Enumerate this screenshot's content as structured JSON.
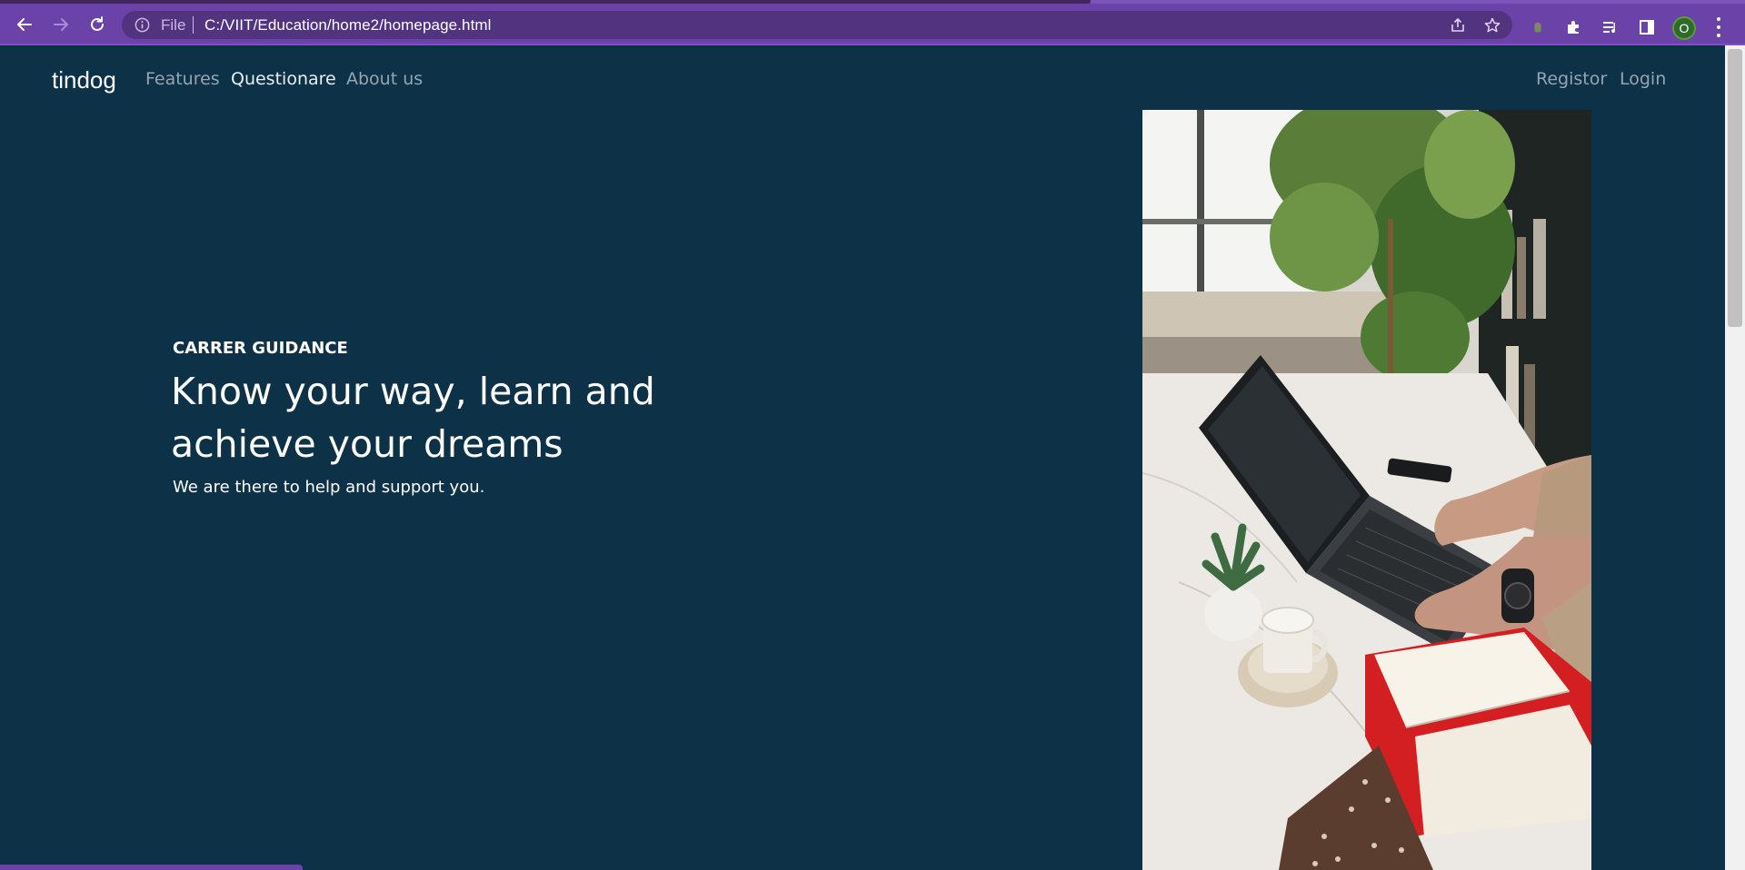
{
  "browser": {
    "omnibox": {
      "scheme_label": "File",
      "url": "C:/VIIT/Education/home2/homepage.html"
    },
    "profile_initial": "O",
    "icons": {
      "back": "back-arrow-icon",
      "forward": "forward-arrow-icon",
      "reload": "reload-icon",
      "info": "info-icon",
      "share": "share-icon",
      "bookmark": "star-icon",
      "extension1": "extension-icon",
      "extensions": "puzzle-icon",
      "media": "media-queue-icon",
      "side_panel": "side-panel-icon",
      "menu": "kebab-menu-icon"
    },
    "colors": {
      "frame": "#6a42a8",
      "omnibox": "#52337f"
    }
  },
  "navbar": {
    "brand": "tindog",
    "links": [
      "Features",
      "Questionare",
      "About us"
    ],
    "active_link": "Questionare",
    "right_links": [
      "Registor",
      "Login"
    ]
  },
  "hero": {
    "eyebrow": "CARRER GUIDANCE",
    "headline_line1": "Know your way, learn and",
    "headline_line2": "achieve your dreams",
    "subtext": "We are there to help and support you.",
    "image_subject": "person typing on laptop at desk with plant, cup and notebook"
  },
  "colors": {
    "page_background": "#0d3147",
    "text": "#ffffff",
    "nav_link": "#93a6b2"
  }
}
